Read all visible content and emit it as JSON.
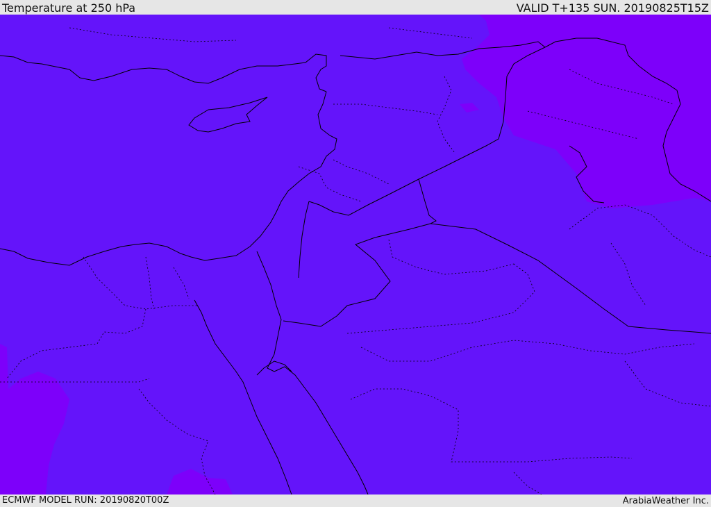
{
  "header": {
    "title": "Temperature at 250 hPa",
    "valid_time": "VALID T+135 SUN. 20190825T15Z"
  },
  "footer": {
    "model_run": "ECMWF MODEL RUN: 20190820T00Z",
    "credit": "ArabiaWeather Inc."
  },
  "colors": {
    "base_field": "#6414fa",
    "warm_field": "#7d00fa",
    "coastline": "#000000",
    "background": "#e6e6e6"
  }
}
